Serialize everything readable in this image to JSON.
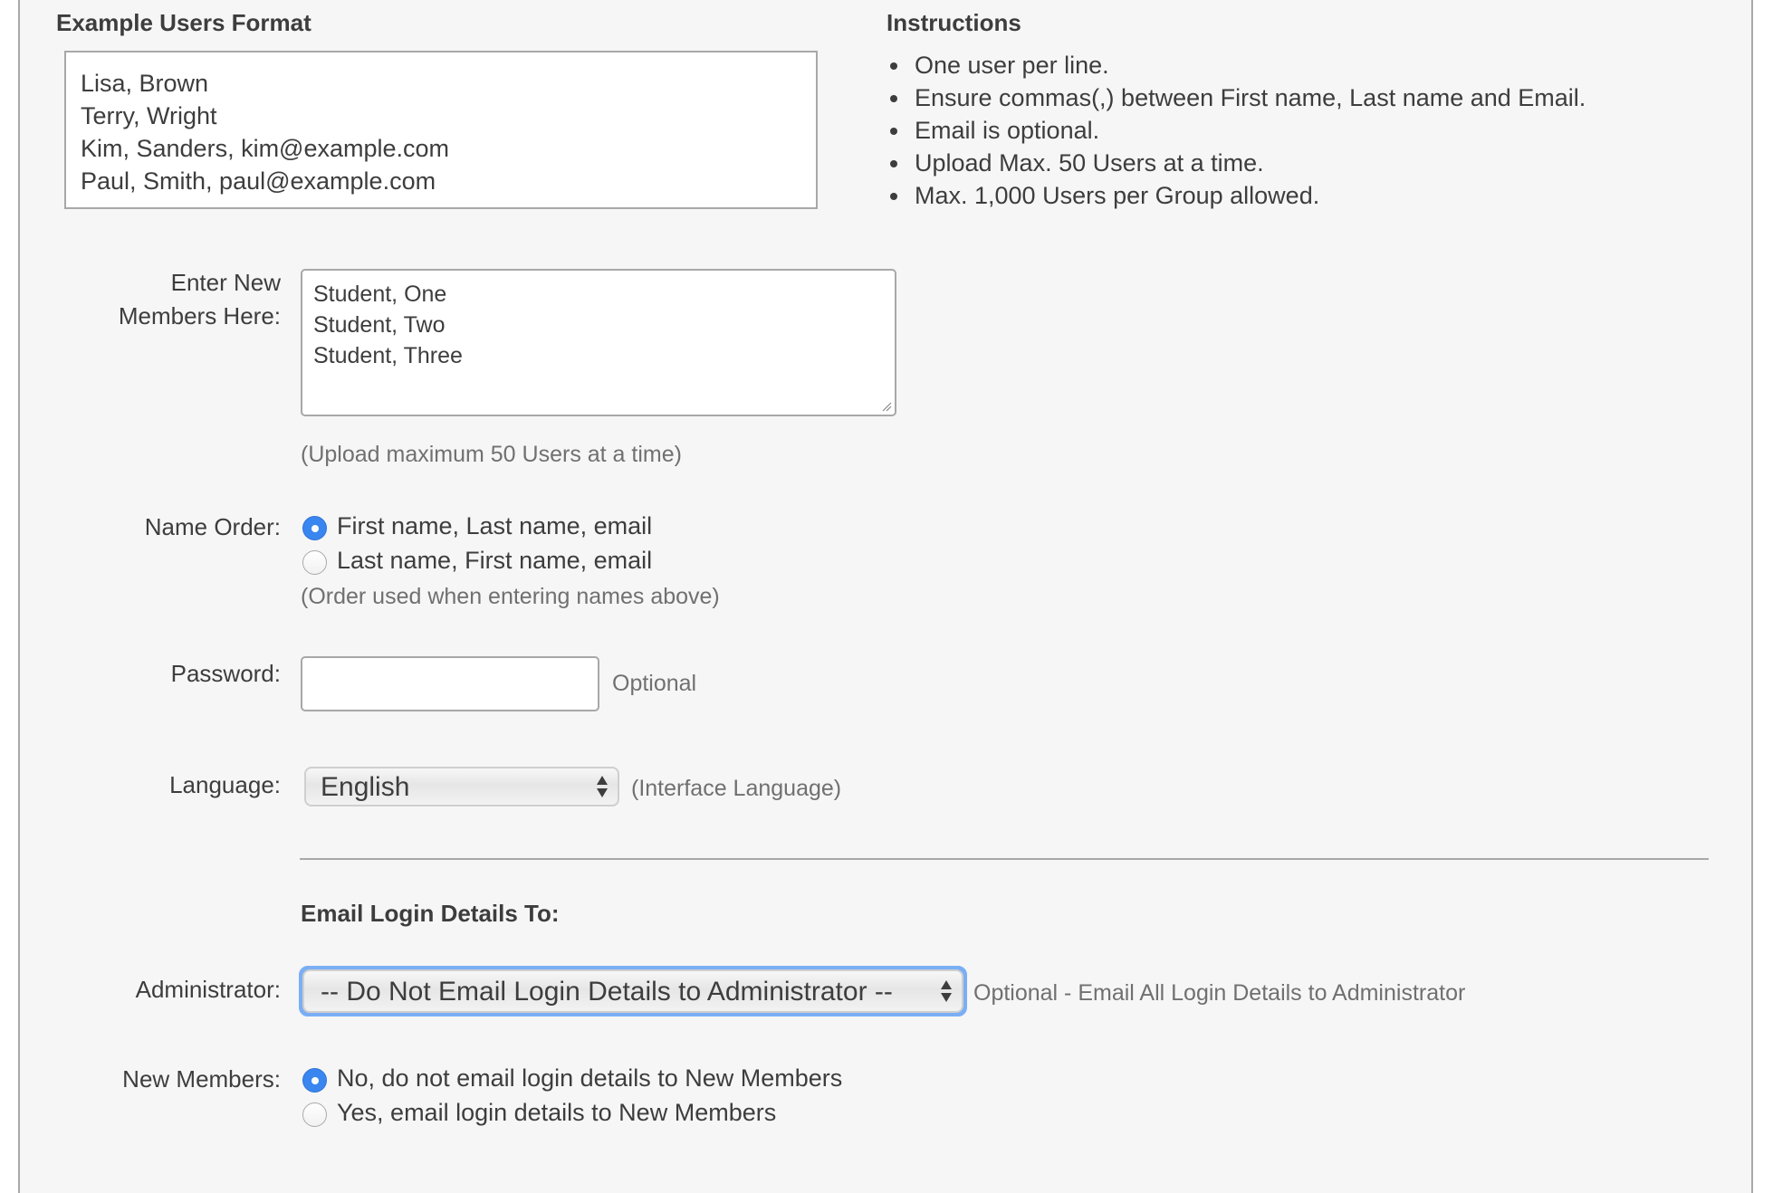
{
  "example": {
    "heading": "Example Users Format",
    "lines": [
      "Lisa, Brown",
      "Terry, Wright",
      "Kim, Sanders, kim@example.com",
      "Paul, Smith, paul@example.com"
    ]
  },
  "instructions": {
    "heading": "Instructions",
    "items": [
      "One user per line.",
      "Ensure commas(,) between First name, Last name and Email.",
      "Email is optional.",
      "Upload Max. 50 Users at a time.",
      "Max. 1,000 Users per Group allowed."
    ]
  },
  "members": {
    "label_line1": "Enter New",
    "label_line2": "Members Here:",
    "value_lines": [
      "Student, One",
      "Student, Two",
      "Student, Three"
    ],
    "note": "(Upload maximum 50 Users at a time)"
  },
  "name_order": {
    "label": "Name Order:",
    "options": [
      {
        "label": "First name, Last name, email",
        "selected": true
      },
      {
        "label": "Last name, First name, email",
        "selected": false
      }
    ],
    "note": "(Order used when entering names above)"
  },
  "password": {
    "label": "Password:",
    "value": "",
    "hint": "Optional"
  },
  "language": {
    "label": "Language:",
    "selected": "English",
    "hint": "(Interface Language)"
  },
  "email_section": {
    "heading": "Email Login Details To:",
    "administrator": {
      "label": "Administrator:",
      "selected": "-- Do Not Email Login Details to Administrator --",
      "hint": "Optional - Email All Login Details to Administrator"
    },
    "new_members": {
      "label": "New Members:",
      "options": [
        {
          "label": "No, do not email login details to New Members",
          "selected": true
        },
        {
          "label": "Yes, email login details to New Members",
          "selected": false
        }
      ]
    }
  },
  "colors": {
    "accent": "#3a86f0",
    "focus_ring": "#7aaef5",
    "panel_bg": "#f6f6f6"
  }
}
